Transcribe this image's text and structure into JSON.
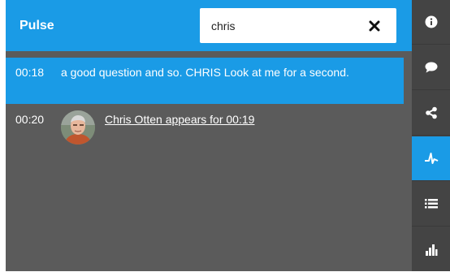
{
  "header": {
    "title": "Pulse",
    "search_value": "chris"
  },
  "results": [
    {
      "time": "00:18",
      "text": "a good question and so. CHRIS Look at me for a second.",
      "highlighted": true
    },
    {
      "time": "00:20",
      "link": "Chris Otten appears for 00:19",
      "avatar": "person-avatar"
    }
  ],
  "sidebar": {
    "items": [
      {
        "icon": "info-icon"
      },
      {
        "icon": "chat-icon"
      },
      {
        "icon": "share-icon"
      },
      {
        "icon": "pulse-icon",
        "active": true
      },
      {
        "icon": "list-icon"
      },
      {
        "icon": "bar-chart-icon"
      }
    ]
  },
  "colors": {
    "accent": "#1a9be6",
    "panel": "#5b5b5b",
    "sidebar": "#444444"
  }
}
